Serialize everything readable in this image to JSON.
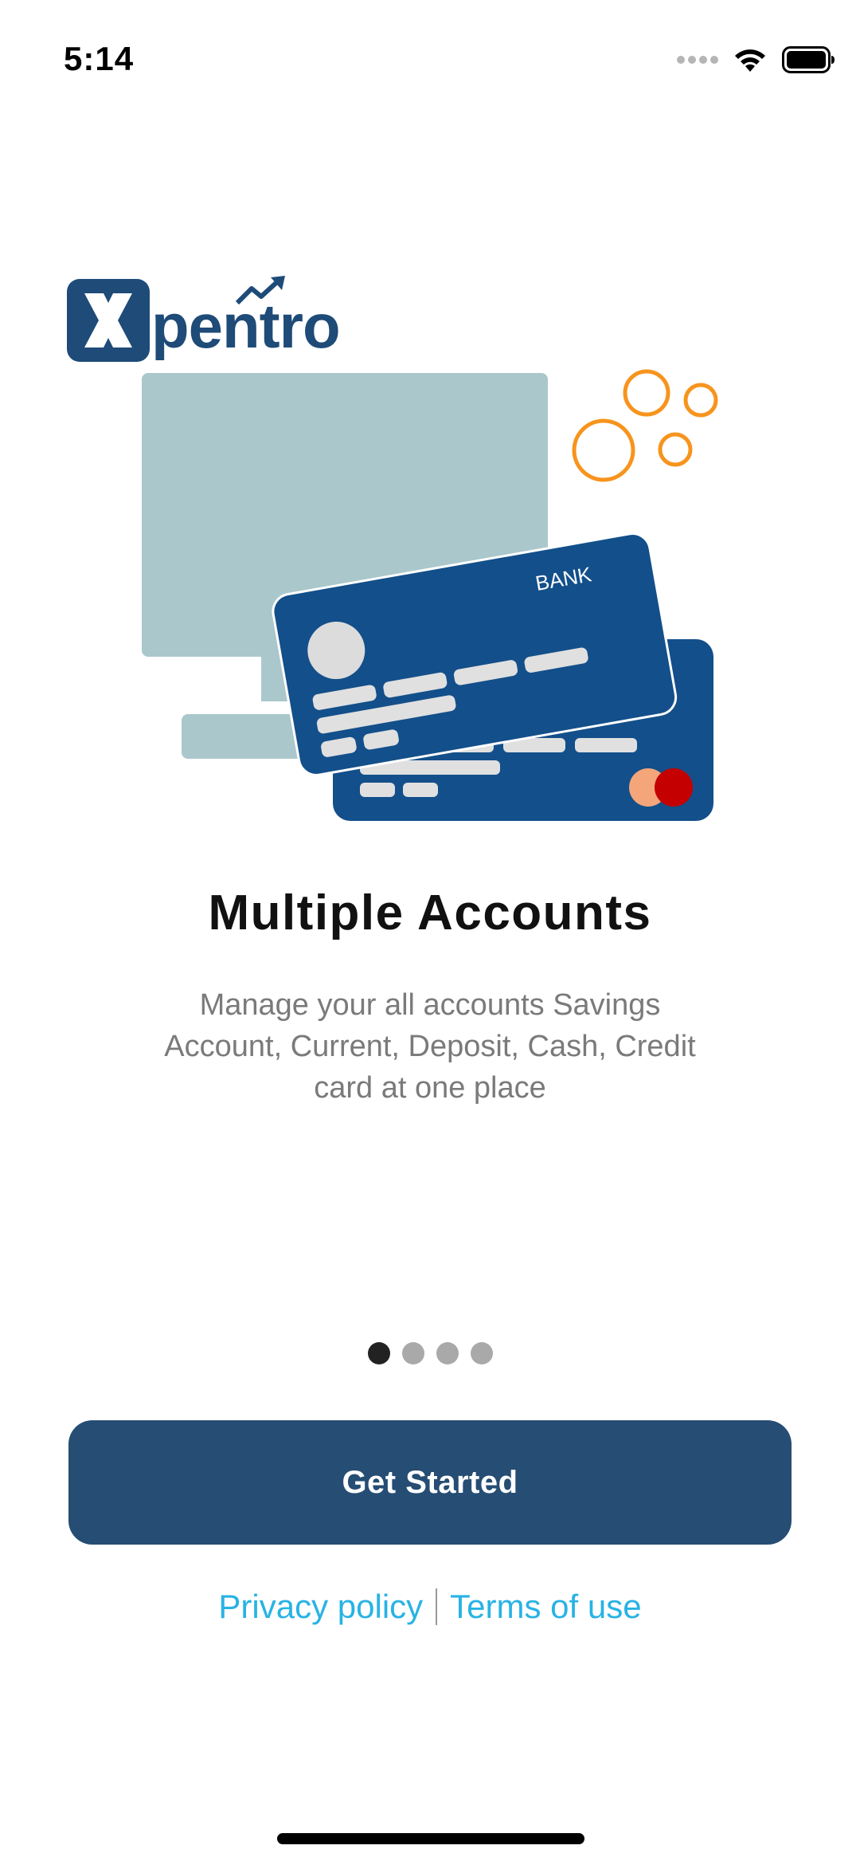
{
  "status_bar": {
    "time": "5:14",
    "icons": [
      "cellular-dots-icon",
      "wifi-icon",
      "battery-icon"
    ]
  },
  "logo": {
    "text": "pentro",
    "mark_letter": "X",
    "brand_color": "#1e4b78"
  },
  "illustration": {
    "card_label": "BANK",
    "monitor_color": "#aac7cc",
    "card_color": "#134f8a",
    "bubble_color": "#f7941d"
  },
  "onboarding": {
    "title": "Multiple Accounts",
    "description": "Manage your all accounts Savings Account, Current, Deposit, Cash, Credit card at one place",
    "page_count": 4,
    "active_page": 1
  },
  "cta": {
    "label": "Get Started",
    "color": "#264d73"
  },
  "footer": {
    "privacy_label": "Privacy policy",
    "terms_label": "Terms of use",
    "link_color": "#28b3e4"
  }
}
